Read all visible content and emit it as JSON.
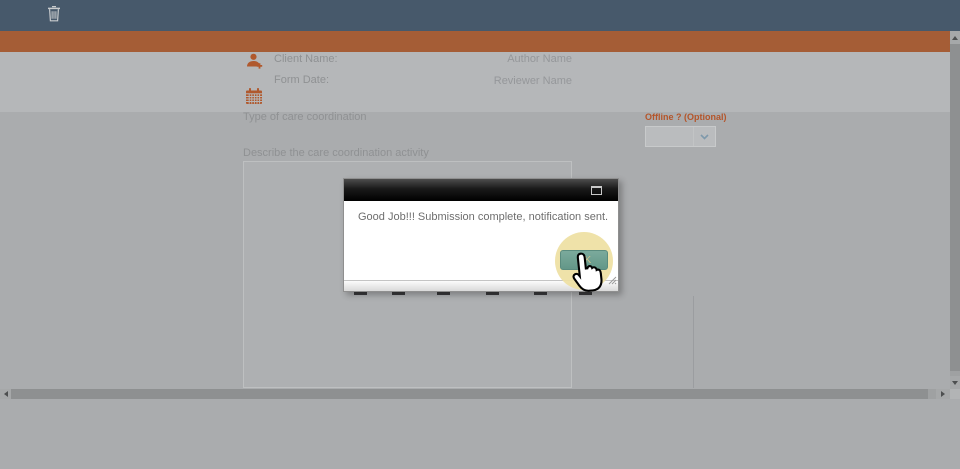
{
  "topbar": {
    "icons": {
      "trash": "trash-can"
    }
  },
  "form": {
    "header": {
      "client_name_label": "Client Name:",
      "form_date_label": "Form Date:",
      "author_name_label": "Author Name",
      "reviewer_name_label": "Reviewer Name",
      "icons": {
        "add_person": "person-with-plus",
        "calendar": "calendar-grid"
      }
    },
    "type_of_care_label": "Type of care coordination",
    "offline": {
      "label": "Offline ? (Optional)",
      "value": "",
      "icon": "chevron-down"
    },
    "describe": {
      "label": "Describe the care coordination activity",
      "value": ""
    }
  },
  "dialog": {
    "message": "Good Job!!! Submission complete, notification sent.",
    "ok_button_label": "OK",
    "icons": {
      "maximize": "maximize-square",
      "resize_grip": "diagonal-grip",
      "click_cursor": "hand-pointer",
      "click_highlight": "yellow-circle"
    }
  },
  "colors": {
    "topbar_blue": "#47596b",
    "accent_orange_bar": "#a55d36",
    "orange_label": "#b4552a",
    "orange_icon": "#b0592e",
    "background_gray": "#aaacae",
    "header_band_gray": "#b5b7b9",
    "label_gray": "#8f9193",
    "dialog_message_gray": "#6e6e6e",
    "ok_button_teal": "#6fa294",
    "highlight_yellow": "#eee0a2",
    "scrollbar_thumb": "#8e9091"
  }
}
